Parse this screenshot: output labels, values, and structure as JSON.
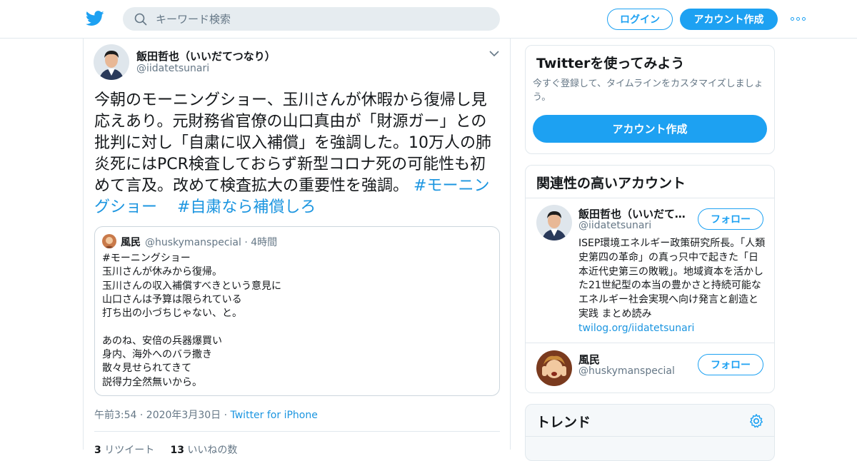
{
  "header": {
    "search_placeholder": "キーワード検索",
    "login_label": "ログイン",
    "signup_label": "アカウント作成"
  },
  "tweet": {
    "author_name": "飯田哲也（いいだてつなり）",
    "author_handle": "@iidatetsunari",
    "text": "今朝のモーニングショー、玉川さんが休暇から復帰し見応えあり。元財務省官僚の山口真由が「財源ガー」との批判に対し「自粛に収入補償」を強調した。10万人の肺炎死にはPCR検査しておらず新型コロナ死の可能性も初めて言及。改めて検査拡大の重要性を強調。",
    "hashtags": [
      "#モーニングショー",
      "#自粛なら補償しろ"
    ],
    "timestamp": "午前3:54 · 2020年3月30日",
    "separator": "·",
    "source": "Twitter for iPhone",
    "retweets": "3",
    "retweets_label": "リツイート",
    "likes": "13",
    "likes_label": "いいねの数"
  },
  "quoted": {
    "name": "風民",
    "handle": "@huskymanspecial",
    "time": "4時間",
    "text": "#モーニングショー\n玉川さんが休みから復帰。\n玉川さんの収入補償すべきという意見に\n山口さんは予算は限られている\n打ち出の小づちじゃない、と。\n\nあのね、安倍の兵器爆買い\n身内、海外へのバラ撒き\n散々見せられてきて\n説得力全然無いから。"
  },
  "sidebar": {
    "try_title": "Twitterを使ってみよう",
    "try_sub": "今すぐ登録して、タイムラインをカスタマイズしましょう。",
    "try_button": "アカウント作成",
    "related_title": "関連性の高いアカウント",
    "accounts": [
      {
        "name": "飯田哲也（いいだてつなり）",
        "handle": "@iidatetsunari",
        "follow": "フォロー",
        "bio": "ISEP環境エネルギー政策研究所長。「人類史第四の革命」の真っ只中で起きた「日本近代史第三の敗戦」。地域資本を活かした21世紀型の本当の豊かさと持続可能なエネルギー社会実現へ向け発言と創造と実践 まとめ読み",
        "link": "twilog.org/iidatetsunari"
      },
      {
        "name": "風民",
        "handle": "@huskymanspecial",
        "follow": "フォロー"
      }
    ],
    "trends_title": "トレンド"
  },
  "colors": {
    "brand": "#1da1f2",
    "link": "#1b95e0",
    "muted": "#657786"
  },
  "icons": [
    "twitter-bird-icon",
    "search-icon",
    "more-dots-icon",
    "chevron-down-icon",
    "gear-icon"
  ]
}
